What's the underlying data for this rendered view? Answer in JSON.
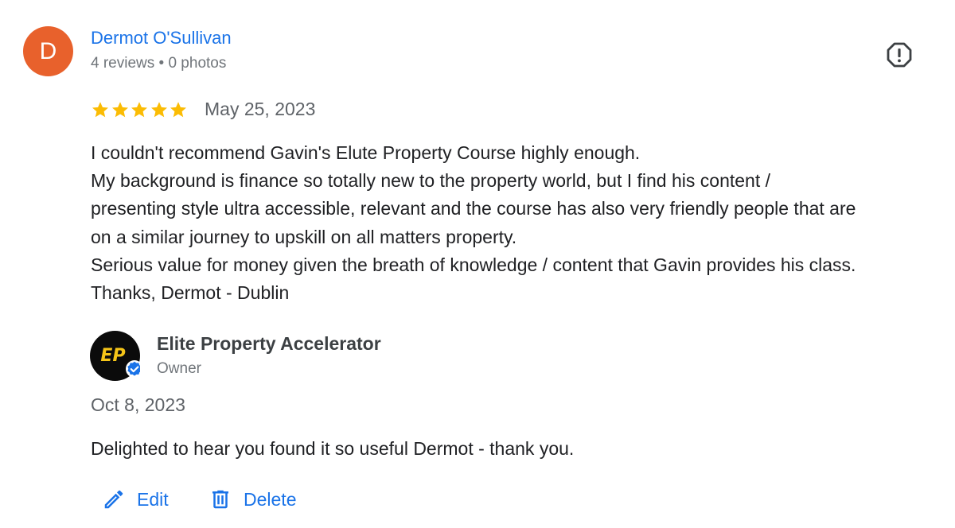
{
  "reviewer": {
    "initial": "D",
    "name": "Dermot O'Sullivan",
    "meta": "4 reviews • 0 photos",
    "avatar_color": "#e8612c"
  },
  "report_icon": "report-octagon-icon",
  "review": {
    "rating": 5,
    "max_rating": 5,
    "star_color": "#fbbc04",
    "date": "May 25, 2023",
    "lines": [
      "I couldn't recommend Gavin's Elute Property Course highly enough.",
      "My background is finance so totally new to the property world, but I find his content /",
      "presenting style ultra accessible, relevant and the course has also very friendly people that are",
      "on a similar journey to upskill on all matters property.",
      "Serious value for money given the breath of knowledge / content that Gavin provides his class.",
      "Thanks, Dermot - Dublin"
    ]
  },
  "owner_reply": {
    "logo_text": "EP",
    "name": "Elite Property Accelerator",
    "role": "Owner",
    "date": "Oct 8, 2023",
    "text": "Delighted to hear you found it so useful Dermot - thank you."
  },
  "actions": {
    "edit_label": "Edit",
    "delete_label": "Delete",
    "edit_icon": "pencil-icon",
    "delete_icon": "trash-icon"
  },
  "colors": {
    "link_blue": "#1a73e8",
    "verified_blue": "#1a73e8",
    "logo_gold": "#f5c518"
  }
}
